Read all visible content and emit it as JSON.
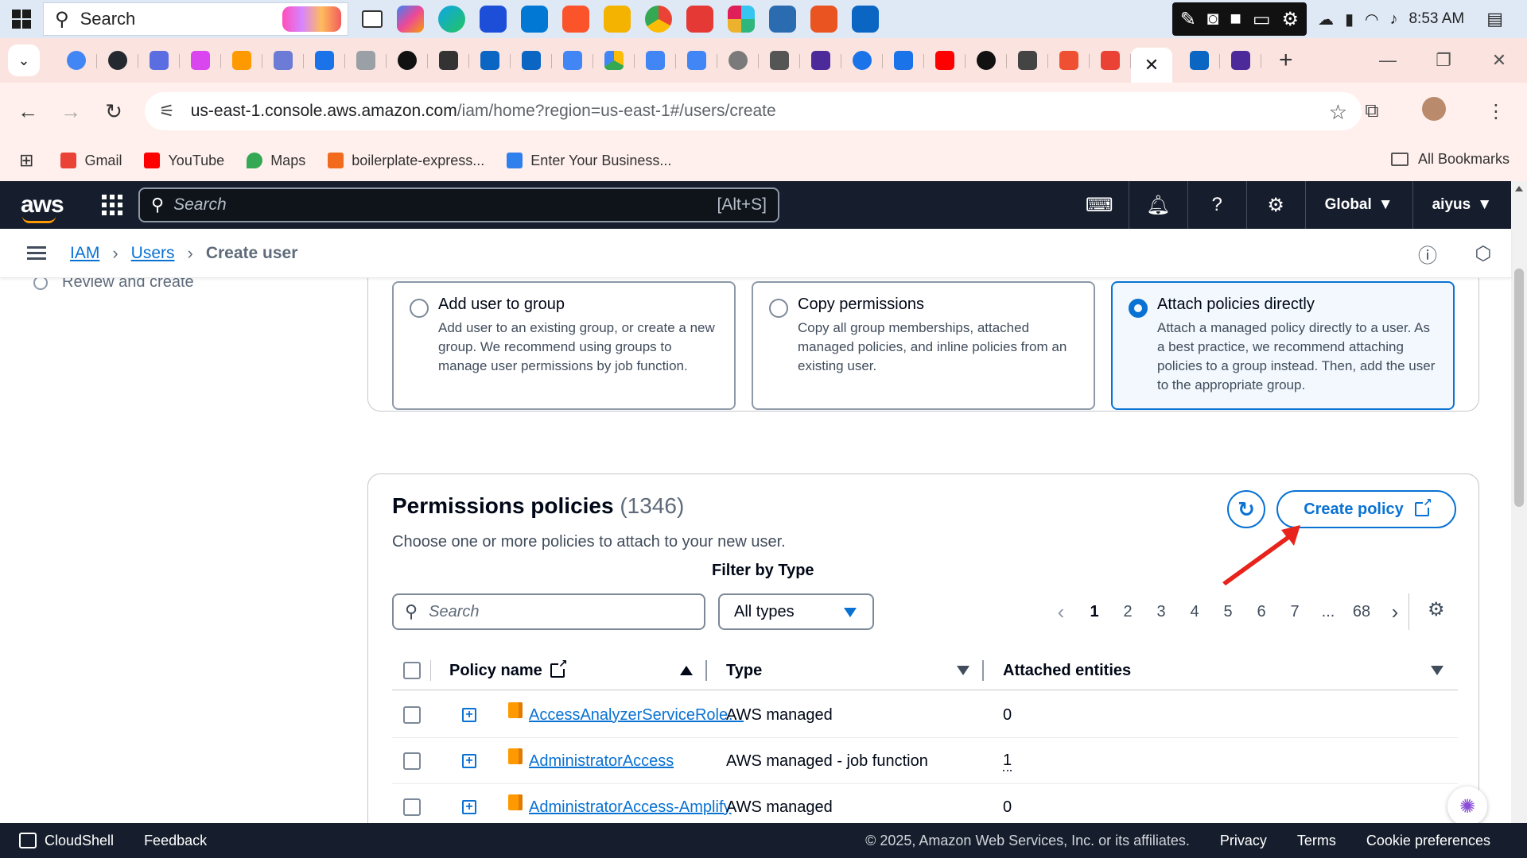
{
  "taskbar": {
    "search_placeholder": "Search",
    "clock": "8:53 AM"
  },
  "browser": {
    "url_host": "us-east-1.console.aws.amazon.com",
    "url_path": "/iam/home?region=us-east-1#/users/create",
    "bookmarks": [
      {
        "label": "Gmail",
        "color": "#ea4335"
      },
      {
        "label": "YouTube",
        "color": "#ff0000"
      },
      {
        "label": "Maps",
        "color": "#34a853"
      },
      {
        "label": "boilerplate-express...",
        "color": "#f26b1d"
      },
      {
        "label": "Enter Your Business...",
        "color": "#2f80ed"
      }
    ],
    "all_bookmarks": "All Bookmarks"
  },
  "aws_nav": {
    "logo": "aws",
    "search_placeholder": "Search",
    "search_shortcut": "[Alt+S]",
    "region": "Global",
    "user": "aiyus"
  },
  "breadcrumb": {
    "items": [
      "IAM",
      "Users"
    ],
    "current": "Create user"
  },
  "steps": {
    "review": "Review and create"
  },
  "permission_options": [
    {
      "title": "Add user to group",
      "desc": "Add user to an existing group, or create a new group. We recommend using groups to manage user permissions by job function.",
      "selected": false
    },
    {
      "title": "Copy permissions",
      "desc": "Copy all group memberships, attached managed policies, and inline policies from an existing user.",
      "selected": false
    },
    {
      "title": "Attach policies directly",
      "desc": "Attach a managed policy directly to a user. As a best practice, we recommend attaching policies to a group instead. Then, add the user to the appropriate group.",
      "selected": true
    }
  ],
  "policies": {
    "title": "Permissions policies",
    "count": "(1346)",
    "subtitle": "Choose one or more policies to attach to your new user.",
    "create_button": "Create policy",
    "filter_label": "Filter by Type",
    "search_placeholder": "Search",
    "type_selected": "All types",
    "pages": [
      "1",
      "2",
      "3",
      "4",
      "5",
      "6",
      "7",
      "...",
      "68"
    ],
    "columns": [
      "Policy name",
      "Type",
      "Attached entities"
    ],
    "rows": [
      {
        "name": "AccessAnalyzerServiceRole…",
        "type": "AWS managed",
        "entities": "0"
      },
      {
        "name": "AdministratorAccess",
        "type": "AWS managed - job function",
        "entities": "1"
      },
      {
        "name": "AdministratorAccess-Amplify",
        "type": "AWS managed",
        "entities": "0"
      }
    ]
  },
  "footer": {
    "cloudshell": "CloudShell",
    "feedback": "Feedback",
    "copyright": "© 2025, Amazon Web Services, Inc. or its affiliates.",
    "privacy": "Privacy",
    "terms": "Terms",
    "cookies": "Cookie preferences"
  },
  "colors": {
    "aws_nav_bg": "#161e2d",
    "link_blue": "#0972d3",
    "aws_orange": "#ff9900",
    "annotation_red": "#e8231b"
  }
}
